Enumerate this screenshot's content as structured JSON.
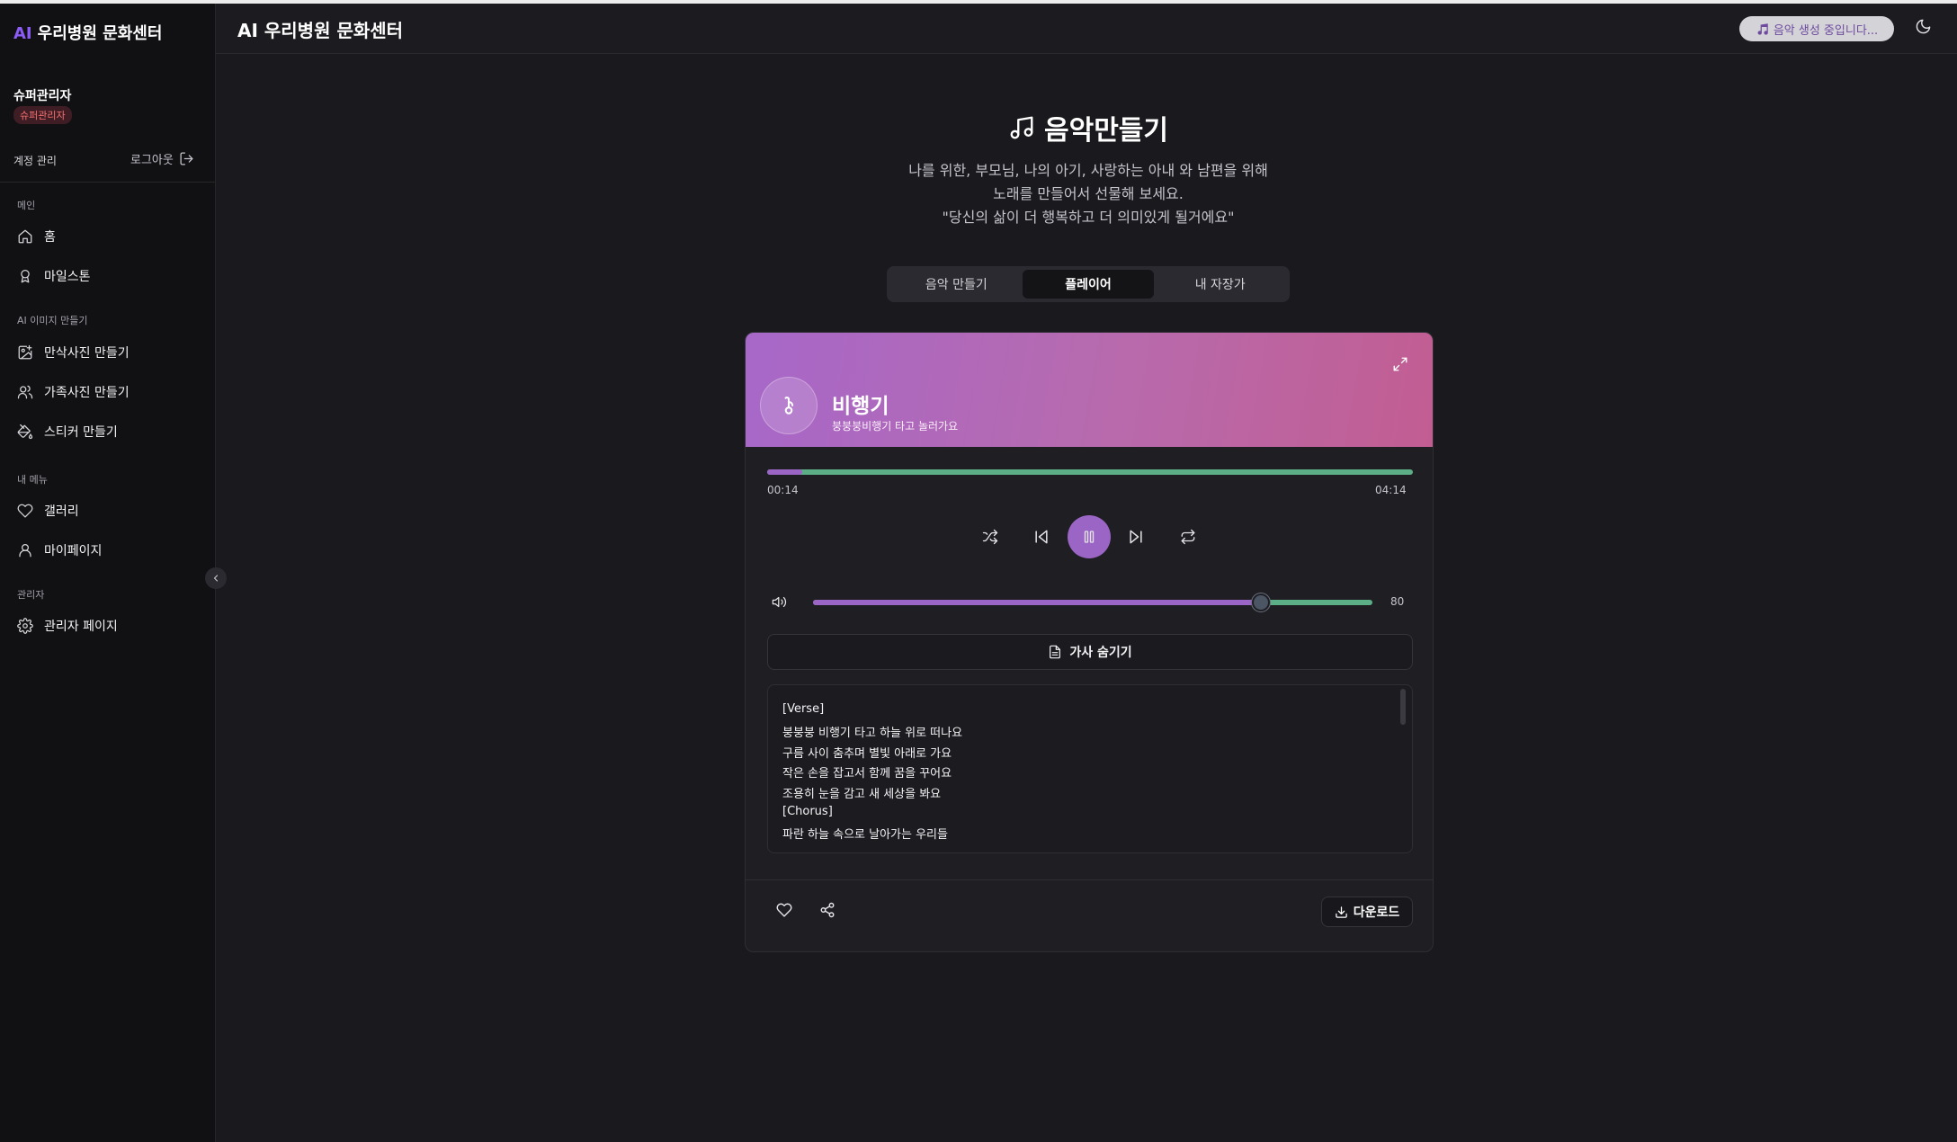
{
  "app": {
    "brand_prefix": "AI",
    "brand_name": "우리병원 문화센터",
    "header_title": "AI 우리병원 문화센터"
  },
  "header": {
    "generating_badge": "음악 생성 중입니다..."
  },
  "user": {
    "name": "슈퍼관리자",
    "role_badge": "슈퍼관리자",
    "account_link": "계정 관리",
    "logout_label": "로그아웃"
  },
  "sidebar": {
    "sections": [
      {
        "title": "메인",
        "items": [
          {
            "label": "홈",
            "icon": "home-icon"
          },
          {
            "label": "마일스톤",
            "icon": "award-icon"
          }
        ]
      },
      {
        "title": "AI 이미지 만들기",
        "items": [
          {
            "label": "만삭사진 만들기",
            "icon": "image-plus-icon"
          },
          {
            "label": "가족사진 만들기",
            "icon": "users-icon"
          },
          {
            "label": "스티커 만들기",
            "icon": "paint-bucket-icon"
          }
        ]
      },
      {
        "title": "내 메뉴",
        "items": [
          {
            "label": "갤러리",
            "icon": "heart-icon"
          },
          {
            "label": "마이페이지",
            "icon": "user-icon"
          }
        ]
      },
      {
        "title": "관리자",
        "items": [
          {
            "label": "관리자 페이지",
            "icon": "settings-icon"
          }
        ]
      }
    ]
  },
  "hero": {
    "title": "음악만들기",
    "description_lines": [
      "나를 위한, 부모님, 나의 아기, 사랑하는 아내 와 남편을 위해",
      "노래를 만들어서 선물해 보세요.",
      "\"당신의 삶이 더 행복하고 더 의미있게 될거에요\""
    ]
  },
  "tabs": [
    {
      "label": "음악 만들기",
      "active": false
    },
    {
      "label": "플레이어",
      "active": true
    },
    {
      "label": "내 자장가",
      "active": false
    }
  ],
  "player": {
    "song_title": "비행기",
    "song_subtitle": "붕붕붕비행기 타고 놀러가요",
    "current_time": "00:14",
    "duration": "04:14",
    "progress_fraction": 0.055,
    "volume": 80,
    "volume_display": "80",
    "lyrics_toggle_label": "가사 숨기기",
    "lyrics": [
      "[Verse]",
      "붕붕붕 비행기 타고 하늘 위로 떠나요",
      "구름 사이 춤추며 별빛 아래로 가요",
      "작은 손을 잡고서 함께 꿈을 꾸어요",
      "조용히 눈을 감고 새 세상을 봐요",
      "[Chorus]",
      "파란 하늘 속으로 날아가는 우리들"
    ],
    "download_label": "다운로드"
  },
  "colors": {
    "accent": "#9b65c6",
    "progress_rest": "#5cae87",
    "header_gradient_start": "#a768c9",
    "header_gradient_end": "#c25d92",
    "role_badge": "#f87171"
  }
}
